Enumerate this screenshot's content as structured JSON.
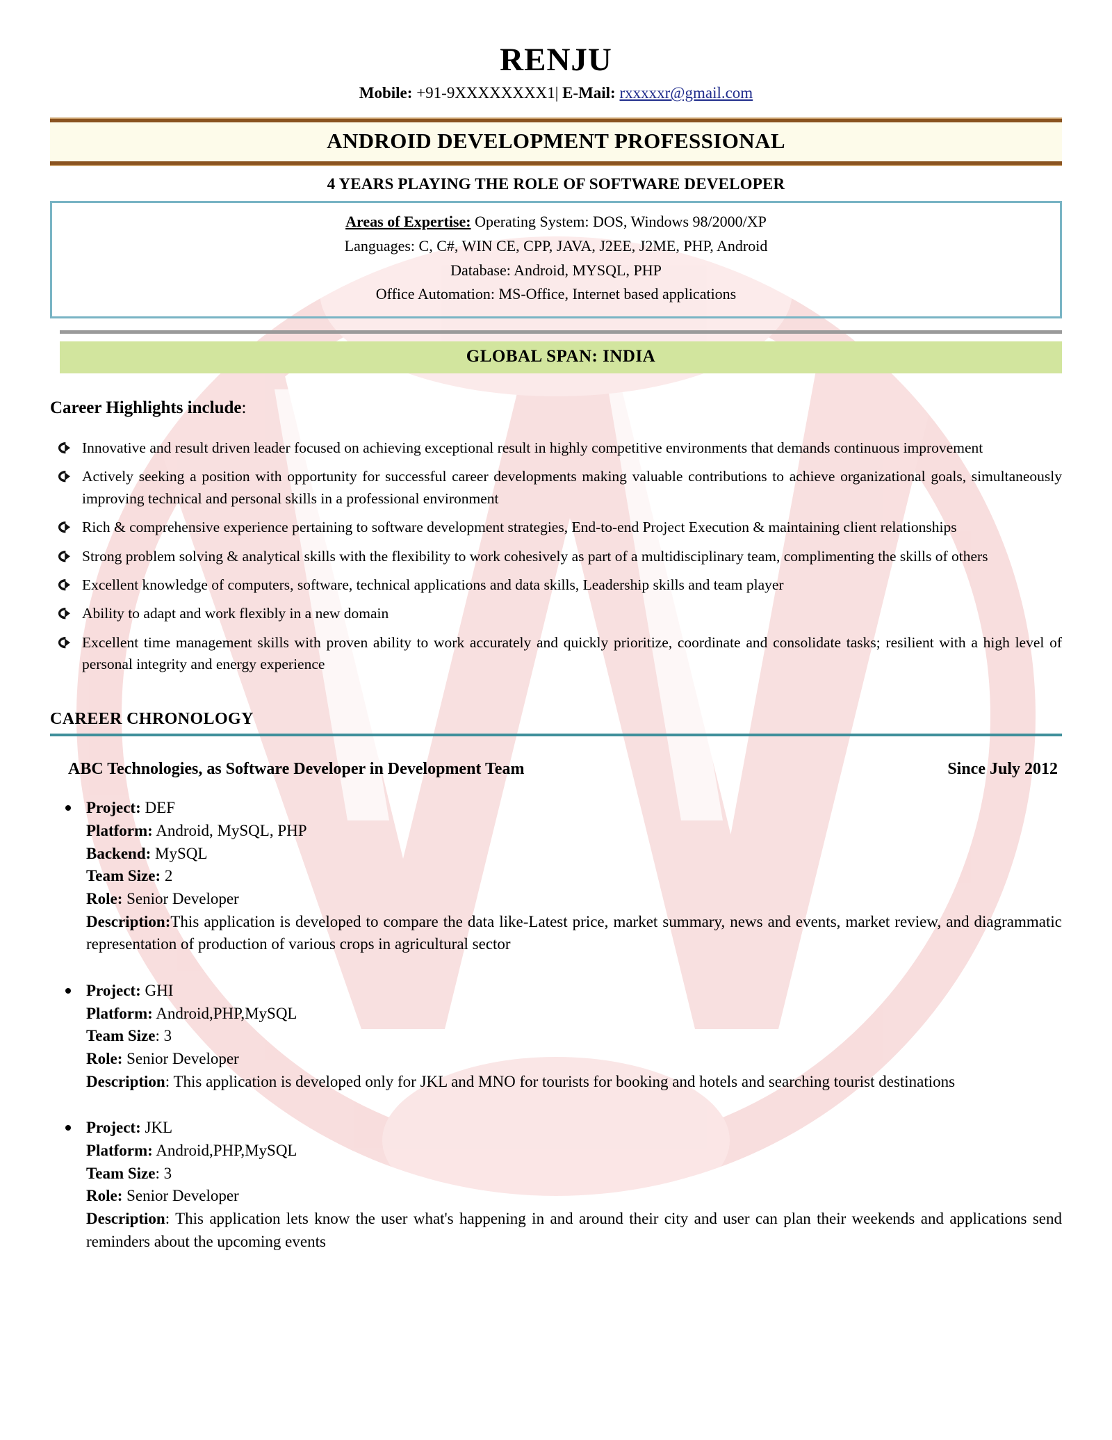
{
  "document": {
    "type": "resume",
    "watermark_text": "W"
  },
  "header": {
    "name": "RENJU",
    "mobile_label": "Mobile:",
    "mobile_value": "+91-9XXXXXXXX1",
    "separator": "|",
    "email_label": "E-Mail:",
    "email_value": "rxxxxxr@gmail.com"
  },
  "banner": {
    "title": "ANDROID DEVELOPMENT PROFESSIONAL",
    "subtitle": "4 YEARS PLAYING THE ROLE OF SOFTWARE DEVELOPER"
  },
  "expertise": {
    "label": "Areas of Expertise:",
    "line1_value": "Operating System: DOS, Windows 98/2000/XP",
    "line2": "Languages: C, C#, WIN CE, CPP, JAVA, J2EE, J2ME, PHP, Android",
    "line3": "Database: Android, MYSQL, PHP",
    "line4": "Office Automation: MS-Office, Internet based applications"
  },
  "global_span": {
    "text": "GLOBAL SPAN: INDIA"
  },
  "highlights": {
    "lead_bold": "Career Highlights include",
    "lead_colon": ":",
    "items": [
      "Innovative and result driven leader focused on achieving exceptional result in highly competitive environments that demands continuous improvement",
      "Actively seeking a position with opportunity for successful career developments making valuable contributions to achieve organizational goals, simultaneously improving technical and personal skills in a professional environment",
      "Rich & comprehensive experience pertaining to software development strategies, End-to-end Project Execution & maintaining client relationships",
      "Strong problem solving & analytical skills with the flexibility to work cohesively as part of a multidisciplinary team, complimenting the skills of others",
      "Excellent knowledge of computers, software, technical applications and data skills, Leadership skills and team player",
      "Ability to adapt and work flexibly in a new domain",
      "Excellent time management skills with proven ability to work accurately and quickly prioritize, coordinate and consolidate tasks; resilient with a high level of personal integrity and energy experience"
    ]
  },
  "chronology": {
    "heading": "CAREER CHRONOLOGY",
    "company": "ABC Technologies, as Software Developer in Development Team",
    "duration": "Since July 2012",
    "projects": [
      {
        "project_label": "Project:",
        "project_value": "DEF",
        "platform_label": "Platform:",
        "platform_value": "Android, MySQL, PHP",
        "backend_label": "Backend:",
        "backend_value": "MySQL",
        "team_size_label": "Team Size:",
        "team_size_value": "2",
        "role_label": "Role:",
        "role_value": "Senior Developer",
        "description_label": "Description:",
        "description_value": "This application is developed to compare the data like-Latest price, market summary, news and events, market review, and diagrammatic representation of production of various crops in agricultural sector"
      },
      {
        "project_label": "Project:",
        "project_value": " GHI",
        "platform_label": "Platform:",
        "platform_value": "Android,PHP,MySQL",
        "backend_label": "",
        "backend_value": "",
        "team_size_label": "Team Size",
        "team_size_value": ": 3",
        "role_label": "Role:",
        "role_value": "Senior Developer",
        "description_label": "Description",
        "description_value": ":  This application is developed only for JKL and MNO for tourists for booking and hotels and searching tourist destinations"
      },
      {
        "project_label": "Project:",
        "project_value": " JKL",
        "platform_label": "Platform:",
        "platform_value": "Android,PHP,MySQL",
        "backend_label": "",
        "backend_value": "",
        "team_size_label": "Team Size",
        "team_size_value": ": 3",
        "role_label": "Role:",
        "role_value": "Senior Developer",
        "description_label": "Description",
        "description_value": ":  This application lets know the user what's happening in and around their city and user can plan their weekends and applications send reminders about the upcoming events"
      }
    ]
  },
  "colors": {
    "brown_rule": "#8a5320",
    "brown_rule_light": "#caa06b",
    "banner_bg": "#fdfbea",
    "box_border": "#79b4c4",
    "gray_rule": "#9a9a9a",
    "green_band": "#d2e59e",
    "teal_rule": "#3f8f9b",
    "email_link": "#1f2c8c",
    "watermark_pink": "#f6cfcf"
  }
}
